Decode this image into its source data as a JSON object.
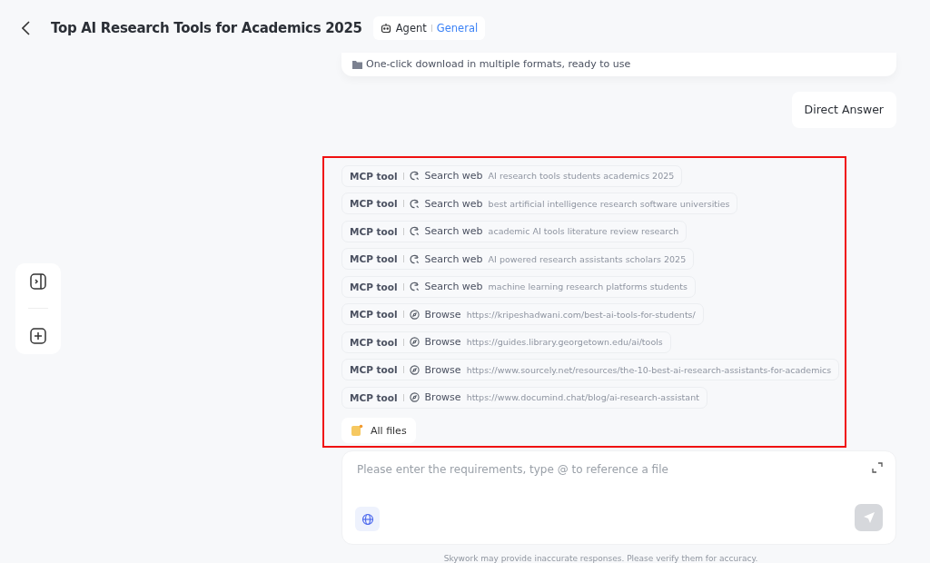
{
  "header": {
    "title": "Top AI Research Tools for Academics 2025",
    "mode": "Agent",
    "category": "General"
  },
  "previous_card": {
    "text": "One-click download in multiple formats, ready to use"
  },
  "user_message": "Direct Answer",
  "tool_calls": [
    {
      "tool": "MCP tool",
      "kind": "search",
      "action": "Search web",
      "detail": "AI research tools students academics 2025"
    },
    {
      "tool": "MCP tool",
      "kind": "search",
      "action": "Search web",
      "detail": "best artificial intelligence research software universities"
    },
    {
      "tool": "MCP tool",
      "kind": "search",
      "action": "Search web",
      "detail": "academic AI tools literature review research"
    },
    {
      "tool": "MCP tool",
      "kind": "search",
      "action": "Search web",
      "detail": "AI powered research assistants scholars 2025"
    },
    {
      "tool": "MCP tool",
      "kind": "search",
      "action": "Search web",
      "detail": "machine learning research platforms students"
    },
    {
      "tool": "MCP tool",
      "kind": "browse",
      "action": "Browse",
      "detail": "https://kripeshadwani.com/best-ai-tools-for-students/"
    },
    {
      "tool": "MCP tool",
      "kind": "browse",
      "action": "Browse",
      "detail": "https://guides.library.georgetown.edu/ai/tools"
    },
    {
      "tool": "MCP tool",
      "kind": "browse",
      "action": "Browse",
      "detail": "https://www.sourcely.net/resources/the-10-best-ai-research-assistants-for-academics"
    },
    {
      "tool": "MCP tool",
      "kind": "browse",
      "action": "Browse",
      "detail": "https://www.documind.chat/blog/ai-research-assistant"
    }
  ],
  "all_files": "All files",
  "composer": {
    "placeholder": "Please enter the requirements, type @ to reference a file"
  },
  "footer": "Skywork may provide inaccurate responses. Please verify them for accuracy."
}
